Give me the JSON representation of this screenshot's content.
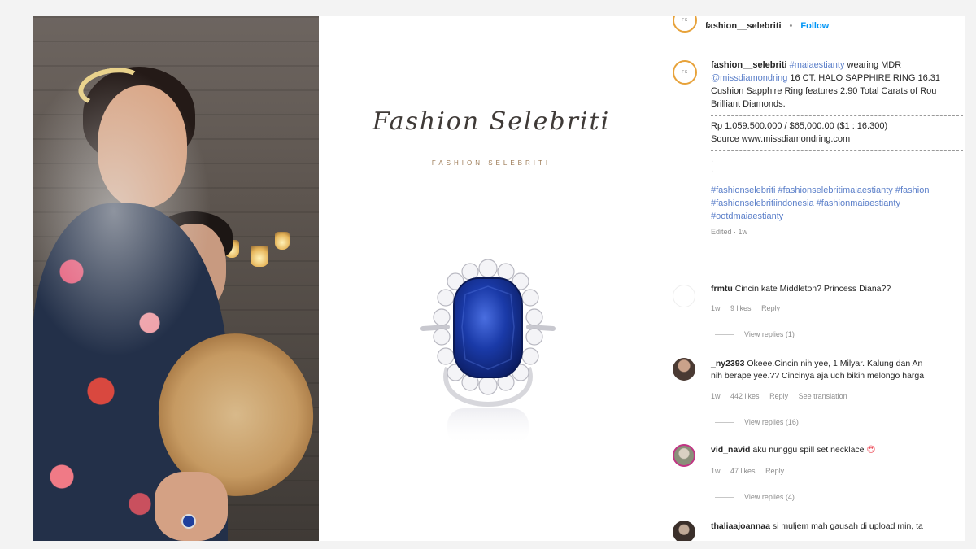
{
  "graphic": {
    "brand_script": "Fashion Selebriti",
    "brand_sub": "FASHION SELEBRITI"
  },
  "header": {
    "username": "fashion__selebriti",
    "separator": "•",
    "follow": "Follow"
  },
  "caption": {
    "username": "fashion__selebriti",
    "hashtag_main": "#maiaestianty",
    "text1": " wearing MDR",
    "mention": "@missdiamondring",
    "text2": " 16 CT. HALO SAPPHIRE RING 16.31",
    "line3": "Cushion Sapphire Ring features 2.90 Total Carats of Rou",
    "line4": "Brilliant Diamonds.",
    "price": "Rp 1.059.500.000 / $65,000.00 ($1 : 16.300)",
    "source": "Source www.missdiamondring.com",
    "dot1": ".",
    "dot2": ".",
    "dot3": ".",
    "hashtags_line1": "#fashionselebriti #fashionselebritimaiaestianty #fashion",
    "hashtags_line2": "#fashionselebritiindonesia #fashionmaiaestianty",
    "hashtags_line3": "#ootdmaiaestianty",
    "edited": "Edited · 1w"
  },
  "comments": [
    {
      "username": "frmtu",
      "text": " Cincin kate Middleton? Princess Diana??",
      "text2": "",
      "time": "1w",
      "likes": "9 likes",
      "reply": "Reply",
      "see_translation": "",
      "view_replies": "View replies (1)"
    },
    {
      "username": "_ny2393",
      "text": " Okeee.Cincin nih yee, 1 Milyar. Kalung dan An",
      "text2": "nih berape yee.?? Cincinya aja udh bikin melongo harga",
      "time": "1w",
      "likes": "442 likes",
      "reply": "Reply",
      "see_translation": "See translation",
      "view_replies": "View replies (16)"
    },
    {
      "username": "vid_navid",
      "text": " aku nunggu spill set necklace ",
      "emoji": "😍",
      "text2": "",
      "time": "1w",
      "likes": "47 likes",
      "reply": "Reply",
      "see_translation": "",
      "view_replies": "View replies (4)"
    },
    {
      "username": "thaliaajoannaa",
      "text": " si muljem mah gausah di upload min, ta",
      "text2": "",
      "time": "",
      "likes": "",
      "reply": "",
      "see_translation": "",
      "view_replies": ""
    }
  ],
  "colors": {
    "follow": "#0095f6",
    "hashtag": "#5b7fc9",
    "sapphire": "#1a3aa8",
    "story_ring": "#e7a23a"
  },
  "icons": {
    "avatar": "fashion-selebriti-logo",
    "heart_emoji": "heart-eyes-emoji"
  }
}
